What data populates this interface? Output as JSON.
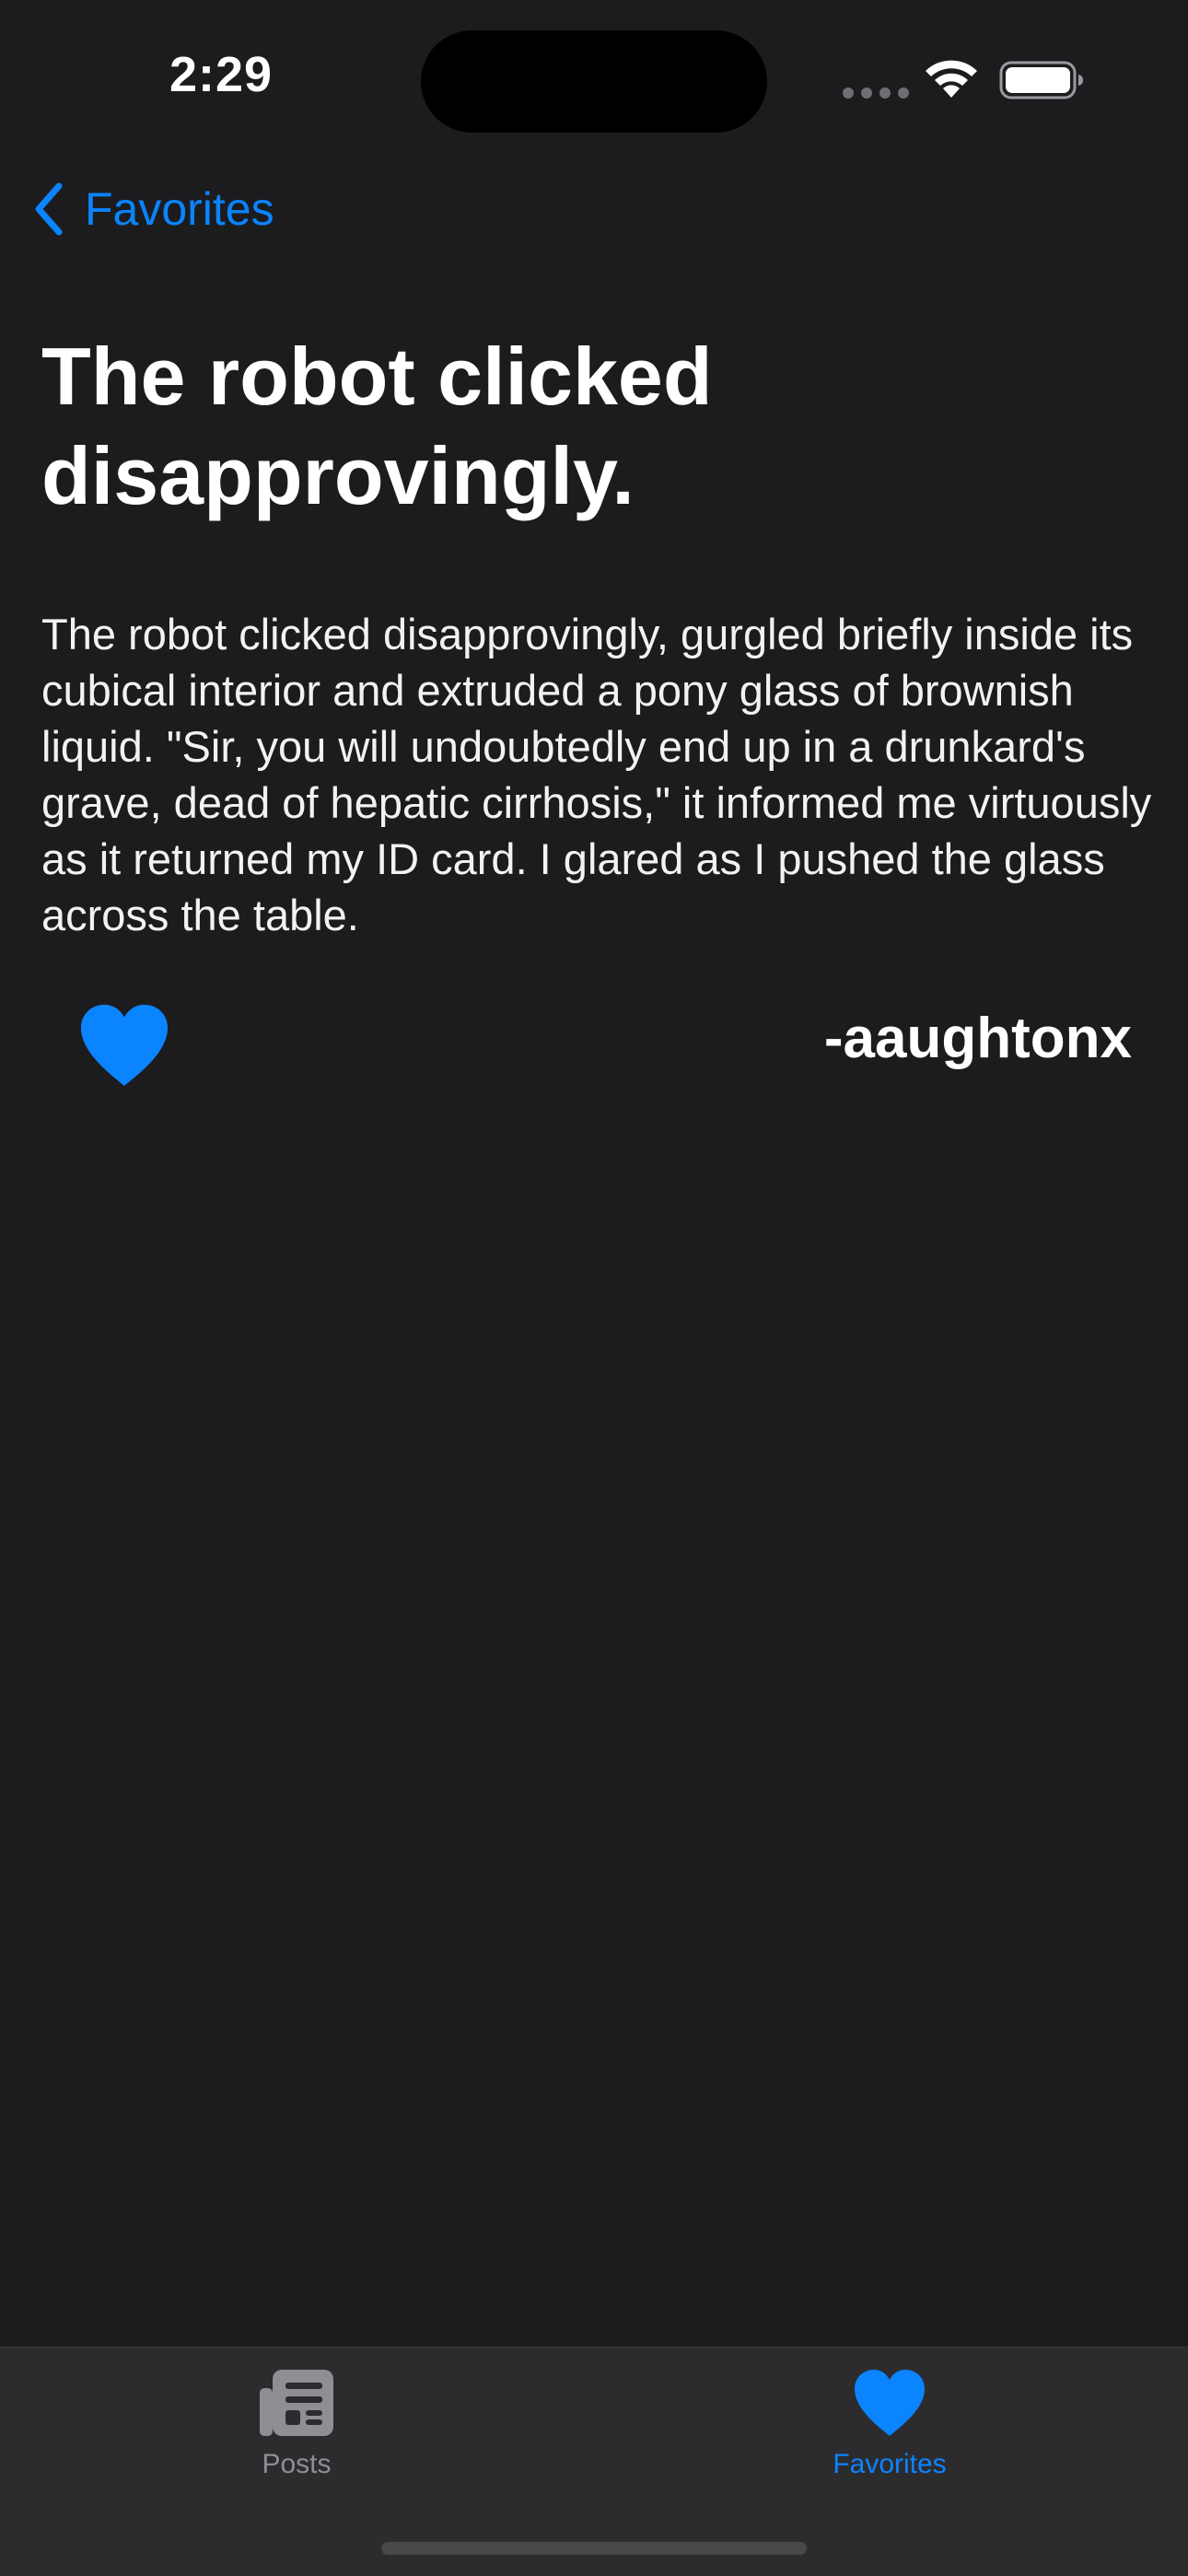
{
  "status_bar": {
    "time": "2:29"
  },
  "nav": {
    "back_label": "Favorites",
    "back_icon": "chevron-left-icon"
  },
  "post": {
    "title": "The robot clicked disapprovingly.",
    "body": "The robot clicked disapprovingly, gurgled briefly inside its cubical interior and extruded a pony glass of brownish liquid. \"Sir, you will undoubtedly end up in a drunkard's grave, dead of hepatic cirrhosis,\" it informed me virtuously as it returned my ID card. I glared as I pushed the glass across the table.",
    "author": "-aaughtonx",
    "favorited": true
  },
  "tab_bar": {
    "tabs": [
      {
        "label": "Posts",
        "icon": "newspaper-icon",
        "selected": false
      },
      {
        "label": "Favorites",
        "icon": "heart-icon",
        "selected": true
      }
    ]
  },
  "colors": {
    "background": "#1c1c1e",
    "accent": "#0a84ff",
    "tab_bar": "#2c2c2e",
    "inactive": "#8e8e93"
  }
}
